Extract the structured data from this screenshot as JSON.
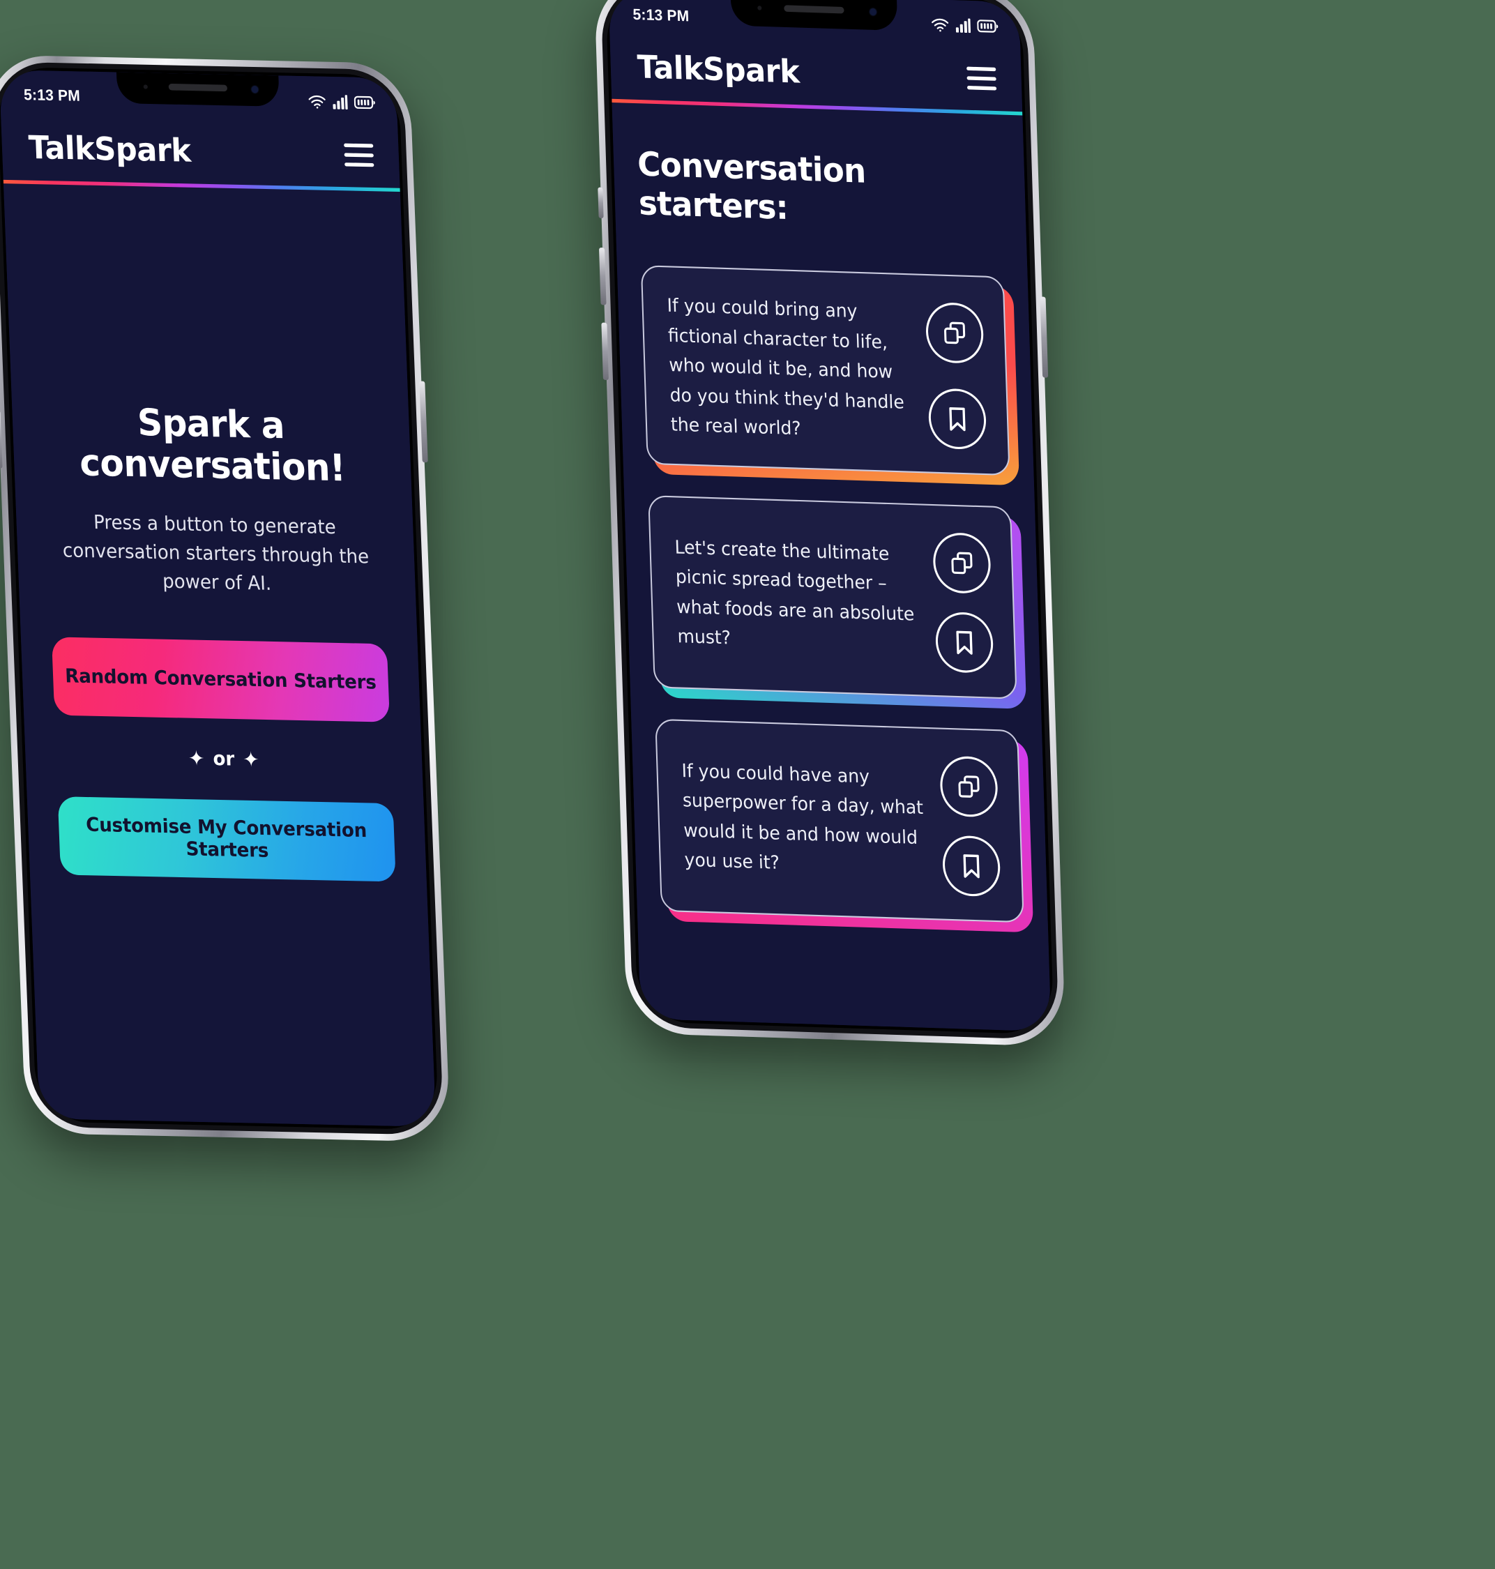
{
  "background_color": "#4a6b52",
  "theme": {
    "screen_bg": "#141539",
    "card_bg": "#1c1d43",
    "text_primary": "#ffffff",
    "text_secondary": "#e2e3ee",
    "gradient_rule": "#ff5a3c → #ef2f7e → #8b54f0 → #24d8cf"
  },
  "status_bar": {
    "time": "5:13 PM",
    "icons": [
      "wifi-icon",
      "cellular-signal-icon",
      "battery-icon"
    ]
  },
  "app_bar": {
    "logo": "TalkSpark",
    "menu_icon": "hamburger-menu-icon"
  },
  "home_screen": {
    "title": "Spark a conversation!",
    "subtitle": "Press a button to generate conversation starters through the power of AI.",
    "primary_button": {
      "label": "Random Conversation Starters",
      "gradient_from": "#fb2e62",
      "gradient_to": "#c93ce0"
    },
    "divider": {
      "text": "or",
      "spark_glyph": "✦"
    },
    "secondary_button": {
      "label": "Customise My Conversation Starters",
      "gradient_from": "#2fe0c8",
      "gradient_to": "#1f92ef"
    }
  },
  "results_screen": {
    "title": "Conversation starters:",
    "card_actions": {
      "copy_label": "copy-icon",
      "bookmark_label": "bookmark-icon"
    },
    "cards": [
      {
        "text": "If you could bring any fictional character to life, who would it be, and how do you think they'd handle the real world?",
        "glow_from": "#f9a33c",
        "glow_to": "#fb4b4b"
      },
      {
        "text": "Let's create the ultimate picnic spread together – what foods are an absolute must?",
        "glow_from": "#2ad9c8",
        "glow_to": "#b84df0"
      },
      {
        "text": "If you could have any superpower for a day, what would it be and how would you use it?",
        "glow_from": "#f82f86",
        "glow_to": "#d13cf0"
      }
    ]
  }
}
